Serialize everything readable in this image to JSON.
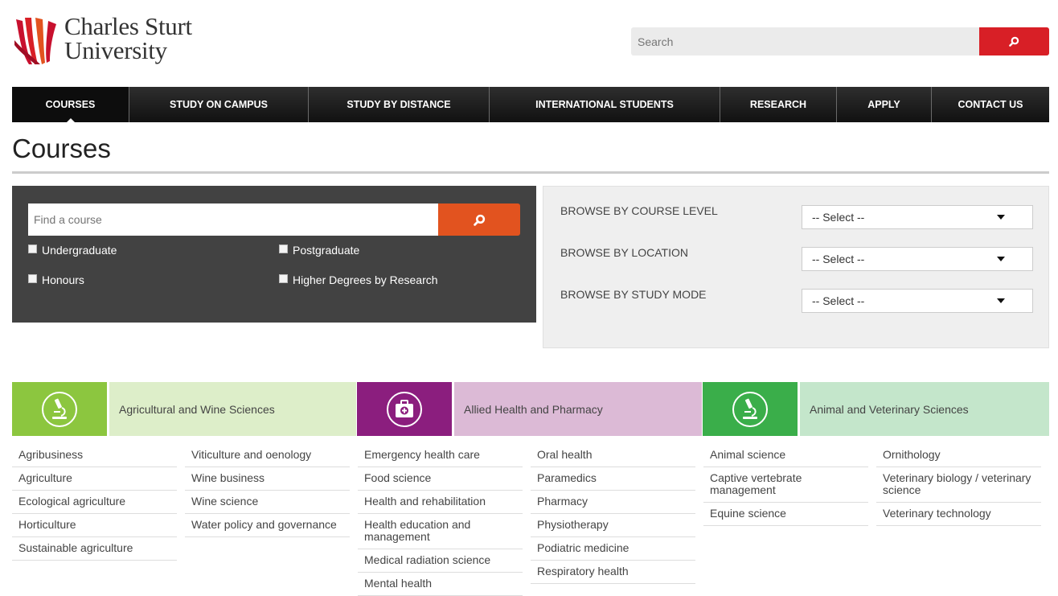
{
  "header": {
    "logo_line1": "Charles Sturt",
    "logo_line2": "University",
    "search_placeholder": "Search",
    "brand_red": "#d81f26"
  },
  "nav": {
    "items": [
      {
        "label": "COURSES",
        "active": true
      },
      {
        "label": "STUDY ON CAMPUS"
      },
      {
        "label": "STUDY BY DISTANCE"
      },
      {
        "label": "INTERNATIONAL STUDENTS"
      },
      {
        "label": "RESEARCH"
      },
      {
        "label": "APPLY"
      },
      {
        "label": "CONTACT US"
      }
    ]
  },
  "page": {
    "title": "Courses"
  },
  "find_course": {
    "placeholder": "Find a course",
    "accent": "#e2531f",
    "checkboxes": [
      {
        "label": "Undergraduate",
        "checked": false
      },
      {
        "label": "Postgraduate",
        "checked": false
      },
      {
        "label": "Honours",
        "checked": false
      },
      {
        "label": "Higher Degrees by Research",
        "checked": false
      }
    ]
  },
  "browse": {
    "rows": [
      {
        "label": "BROWSE BY COURSE LEVEL",
        "value": "-- Select --"
      },
      {
        "label": "BROWSE BY LOCATION",
        "value": "-- Select --"
      },
      {
        "label": "BROWSE BY STUDY MODE",
        "value": "-- Select --"
      }
    ]
  },
  "disciplines": [
    {
      "name": "Agricultural and Wine Sciences",
      "icon": "microscope-icon",
      "icon_color": "#8cc63f",
      "label_color": "#ddeec9",
      "col1": [
        "Agribusiness",
        "Agriculture",
        "Ecological agriculture",
        "Horticulture",
        "Sustainable agriculture"
      ],
      "col2": [
        "Viticulture and oenology",
        "Wine business",
        "Wine science",
        "Water policy and governance"
      ]
    },
    {
      "name": "Allied Health and Pharmacy",
      "icon": "first-aid-kit-icon",
      "icon_color": "#8b1e7e",
      "label_color": "#dcbad6",
      "col1": [
        "Emergency health care",
        "Food science",
        "Health and rehabilitation",
        "Health education and management",
        "Medical radiation science",
        "Mental health"
      ],
      "col2": [
        "Oral health",
        "Paramedics",
        "Pharmacy",
        "Physiotherapy",
        "Podiatric medicine",
        "Respiratory health"
      ]
    },
    {
      "name": "Animal and Veterinary Sciences",
      "icon": "microscope-icon",
      "icon_color": "#3aae4a",
      "label_color": "#c4e6cb",
      "col1": [
        "Animal science",
        "Captive vertebrate management",
        "Equine science"
      ],
      "col2": [
        "Ornithology",
        "Veterinary biology / veterinary science",
        "Veterinary technology"
      ]
    }
  ]
}
